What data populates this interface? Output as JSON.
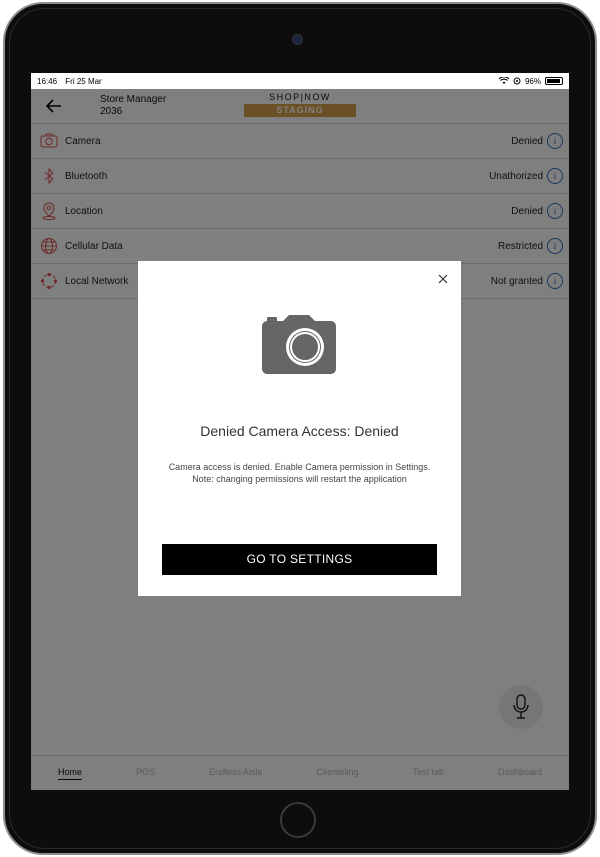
{
  "status_bar": {
    "time": "16:46",
    "date": "Fri 25 Mar",
    "battery": "96%"
  },
  "header": {
    "store_role": "Store Manager",
    "store_number": "2036",
    "logo_text": "SHOP|NOW",
    "environment_badge": "STAGING"
  },
  "permissions": [
    {
      "label": "Camera",
      "status": "Denied",
      "icon": "camera-icon"
    },
    {
      "label": "Bluetooth",
      "status": "Unathorized",
      "icon": "bluetooth-icon"
    },
    {
      "label": "Location",
      "status": "Denied",
      "icon": "location-pin-icon"
    },
    {
      "label": "Cellular Data",
      "status": "Restricted",
      "icon": "globe-icon"
    },
    {
      "label": "Local Network",
      "status": "Not granted",
      "icon": "network-icon"
    }
  ],
  "info_glyph": "i",
  "modal": {
    "title": "Denied Camera Access: Denied",
    "body": "Camera access is denied. Enable Camera permission in Settings. Note: changing permissions will restart the application",
    "button_label": "GO TO SETTINGS"
  },
  "tabs": [
    {
      "label": "Home",
      "active": true
    },
    {
      "label": "POS",
      "active": false
    },
    {
      "label": "Endless Aisle",
      "active": false
    },
    {
      "label": "Clienteling",
      "active": false
    },
    {
      "label": "Test tab",
      "active": false
    },
    {
      "label": "Dashboard",
      "active": false
    }
  ],
  "colors": {
    "accent": "#d9a04a",
    "permission_icon": "#d9534f",
    "info_icon": "#2f6fb8"
  }
}
